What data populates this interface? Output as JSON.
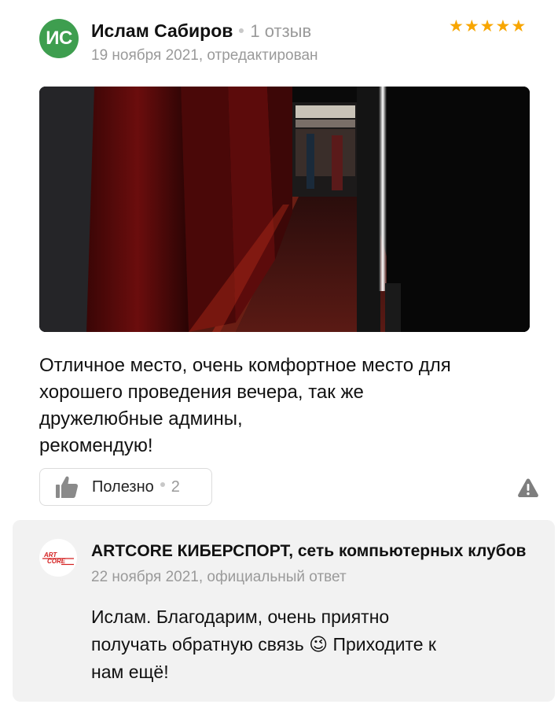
{
  "review": {
    "author_initials": "ИС",
    "author_name": "Ислам Сабиров",
    "review_count": "1 отзыв",
    "date": "19 ноября 2021, отредактирован",
    "rating": 5,
    "stars": [
      "★",
      "★",
      "★",
      "★",
      "★"
    ],
    "text_lines": [
      "Отличное место, очень комфортное место для",
      "хорошего проведения вечера, так же",
      "дружелюбные админы,",
      "рекомендую!"
    ],
    "helpful_label": "Полезно",
    "helpful_count": "2"
  },
  "reply": {
    "org_name": "ARTCORE КИБЕРСПОРТ, сеть компьютерных клубов",
    "date": "22 ноября 2021, официальный ответ",
    "text_lines": [
      "Ислам. Благодарим, очень приятно",
      "получать обратную связь 😉 Приходите к",
      "нам ещё!"
    ],
    "logo_text": "ARTCORE"
  },
  "colors": {
    "avatar": "#3e9e4f",
    "star": "#f8a600",
    "reply_bg": "#f2f2f2",
    "muted_text": "#9a9a9a"
  }
}
